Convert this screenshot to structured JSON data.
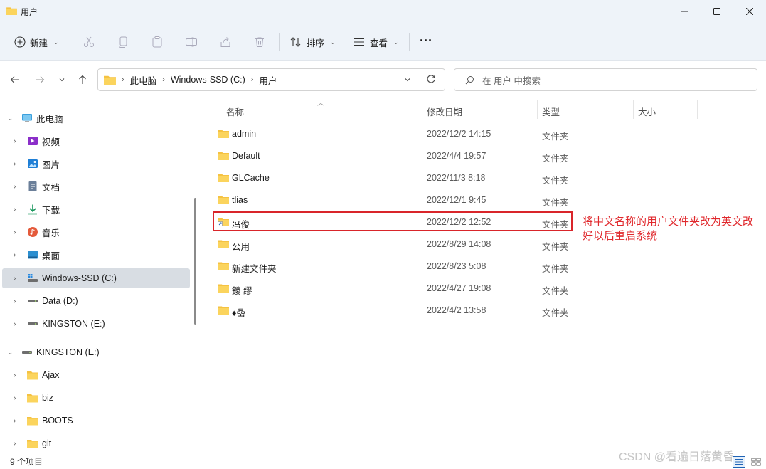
{
  "window": {
    "title": "用户"
  },
  "toolbar": {
    "new_label": "新建",
    "sort_label": "排序",
    "view_label": "查看",
    "more_label": "···"
  },
  "address": {
    "crumbs": [
      "此电脑",
      "Windows-SSD (C:)",
      "用户"
    ]
  },
  "search": {
    "placeholder": "在 用户 中搜索"
  },
  "sidebar": {
    "items": [
      {
        "label": "此电脑"
      },
      {
        "label": "视频"
      },
      {
        "label": "图片"
      },
      {
        "label": "文档"
      },
      {
        "label": "下载"
      },
      {
        "label": "音乐"
      },
      {
        "label": "桌面"
      },
      {
        "label": "Windows-SSD (C:)"
      },
      {
        "label": "Data (D:)"
      },
      {
        "label": "KINGSTON (E:)"
      },
      {
        "label": "KINGSTON (E:)"
      },
      {
        "label": "Ajax"
      },
      {
        "label": "biz"
      },
      {
        "label": "BOOTS"
      },
      {
        "label": "git"
      }
    ]
  },
  "columns": {
    "name": "名称",
    "modified": "修改日期",
    "type": "类型",
    "size": "大小"
  },
  "files": [
    {
      "name": "admin",
      "modified": "2022/12/2 14:15",
      "type": "文件夹"
    },
    {
      "name": "Default",
      "modified": "2022/4/4 19:57",
      "type": "文件夹"
    },
    {
      "name": "GLCache",
      "modified": "2022/11/3 8:18",
      "type": "文件夹"
    },
    {
      "name": "tlias",
      "modified": "2022/12/1 9:45",
      "type": "文件夹"
    },
    {
      "name": "冯俊",
      "modified": "2022/12/2 12:52",
      "type": "文件夹"
    },
    {
      "name": "公用",
      "modified": "2022/8/29 14:08",
      "type": "文件夹"
    },
    {
      "name": "新建文件夹",
      "modified": "2022/8/23 5:08",
      "type": "文件夹"
    },
    {
      "name": "鍐 缪",
      "modified": "2022/4/27 19:08",
      "type": "文件夹"
    },
    {
      "name": "♦嵒",
      "modified": "2022/4/2 13:58",
      "type": "文件夹"
    }
  ],
  "annotation": {
    "text": "将中文名称的用户文件夹改为英文改好以后重启系统"
  },
  "status": {
    "count": "9 个项目"
  },
  "watermark": {
    "text": "CSDN @看遍日落黄昏"
  },
  "colors": {
    "highlight": "#d9252a",
    "folder": "#f5c242",
    "selected_bg": "#d8dde3"
  },
  "icons": {
    "sidebar": [
      "pc-icon",
      "video-icon",
      "picture-icon",
      "document-icon",
      "download-icon",
      "music-icon",
      "desktop-icon",
      "drive-icon",
      "drive-icon",
      "usb-drive-icon",
      "usb-drive-icon",
      "folder-icon",
      "folder-icon",
      "folder-icon",
      "folder-icon"
    ]
  }
}
